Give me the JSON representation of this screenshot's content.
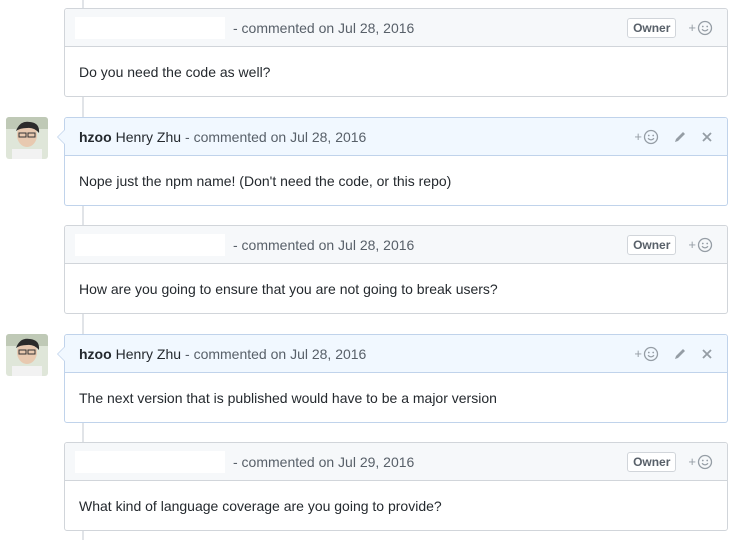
{
  "comments": [
    {
      "author": "",
      "fullname": "",
      "meta": "- commented on Jul 28, 2016",
      "badge": "Owner",
      "react": "+",
      "body": "Do you need the code as well?"
    },
    {
      "author": "hzoo",
      "fullname": "Henry Zhu",
      "meta": "- commented on Jul 28, 2016",
      "react": "+",
      "body": "Nope just the npm name! (Don't need the code, or this repo)"
    },
    {
      "author": "",
      "fullname": "",
      "meta": "- commented on Jul 28, 2016",
      "badge": "Owner",
      "react": "+",
      "body": "How are you going to ensure that you are not going to break users?"
    },
    {
      "author": "hzoo",
      "fullname": "Henry Zhu",
      "meta": "- commented on Jul 28, 2016",
      "react": "+",
      "body": "The next version that is published would have to be a major version"
    },
    {
      "author": "",
      "fullname": "",
      "meta": "- commented on Jul 29, 2016",
      "badge": "Owner",
      "react": "+",
      "body": "What kind of language coverage are you going to provide?"
    }
  ],
  "icons": {
    "reaction": "smiley-icon",
    "edit": "pencil-icon",
    "delete": "close-icon",
    "avatar": "avatar"
  },
  "colors": {
    "own_header_bg": "#f1f8ff",
    "own_border": "#c0d3eb",
    "other_header_bg": "#f6f8fa",
    "border": "#d1d5da"
  }
}
